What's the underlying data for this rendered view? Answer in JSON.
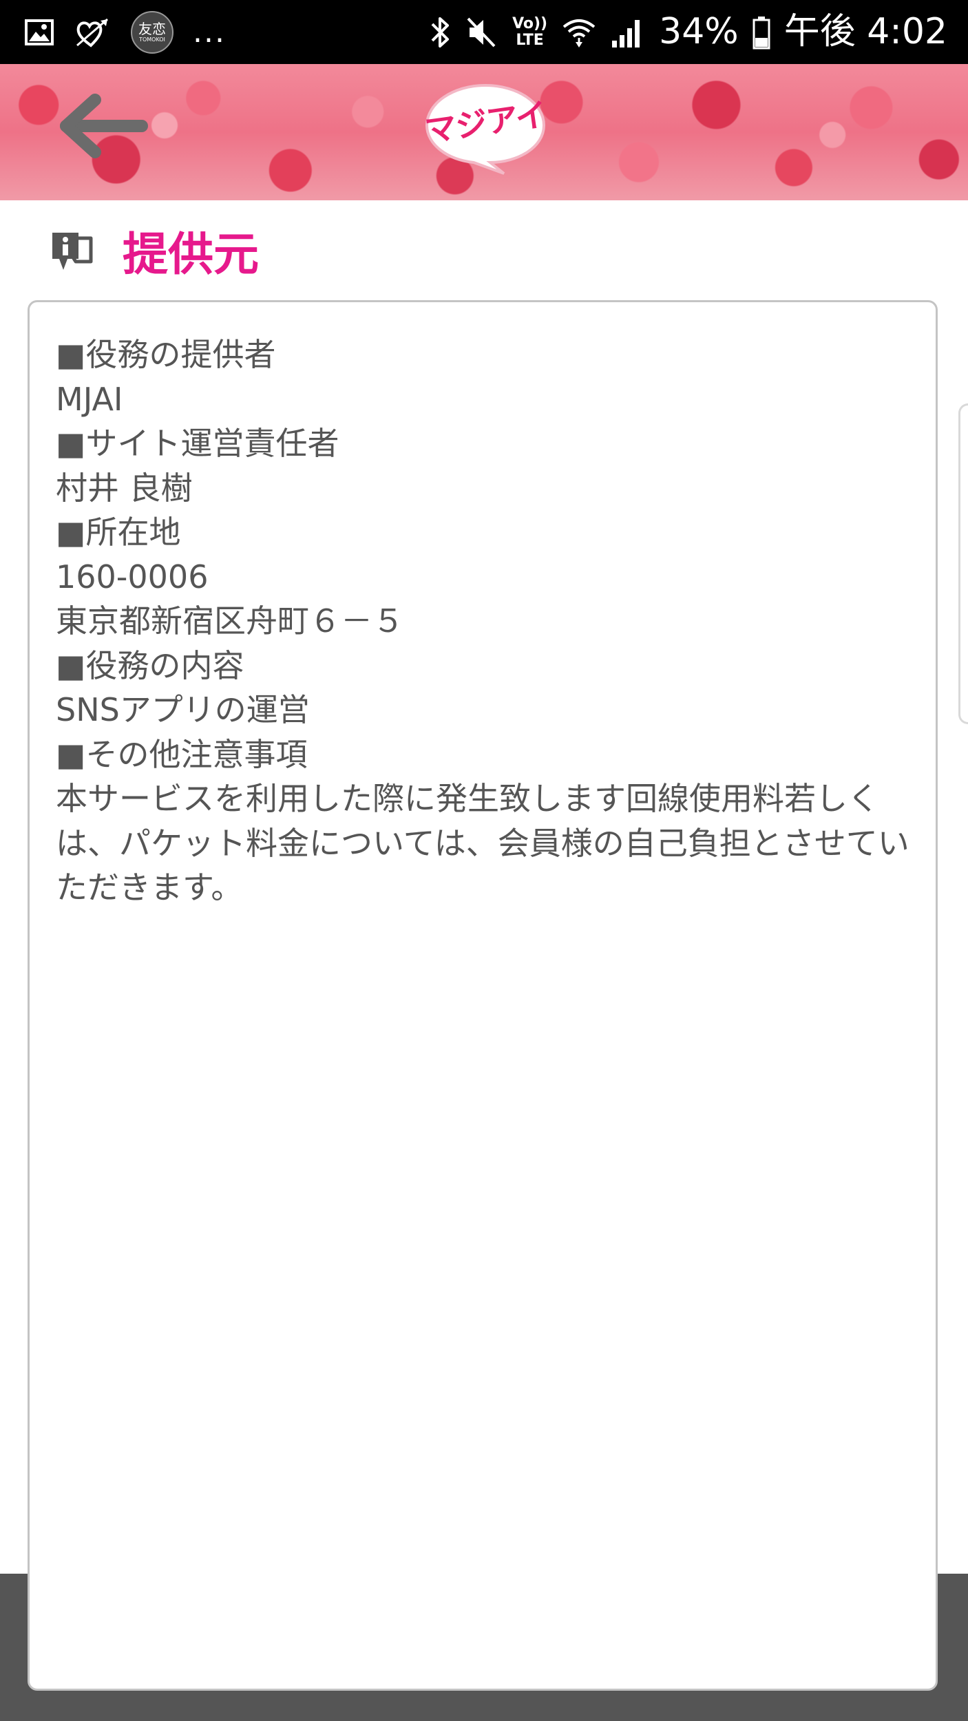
{
  "status_bar": {
    "battery": "34%",
    "time": "午後 4:02",
    "dots": "...",
    "notif_badge": "友恋",
    "notif_badge_sub": "TOMOKOI",
    "lte_top": "Vo))",
    "lte_bottom": "LTE",
    "icons": [
      "image-icon",
      "heart-arrow-icon",
      "tomokoi-icon",
      "bluetooth-icon",
      "mute-icon",
      "volte-icon",
      "wifi-icon",
      "signal-icon",
      "battery-icon"
    ]
  },
  "header": {
    "logo_text": "マジアイ"
  },
  "section": {
    "title": "提供元",
    "icon": "info-speech-icon"
  },
  "content": {
    "lines": [
      "■役務の提供者",
      "MJAI",
      "■サイト運営責任者",
      "村井 良樹",
      "■所在地",
      "160-0006",
      "東京都新宿区舟町６－５",
      "■役務の内容",
      "SNSアプリの運営",
      "■その他注意事項"
    ],
    "notice": "本サービスを利用した際に発生致します回線使用料若しくは、パケット料金については、会員様の自己負担とさせていただきます。"
  },
  "colors": {
    "status_bar_bg": "#000000",
    "title_color": "#e6198c",
    "text_color": "#555555",
    "bottom_bar": "#555555"
  }
}
